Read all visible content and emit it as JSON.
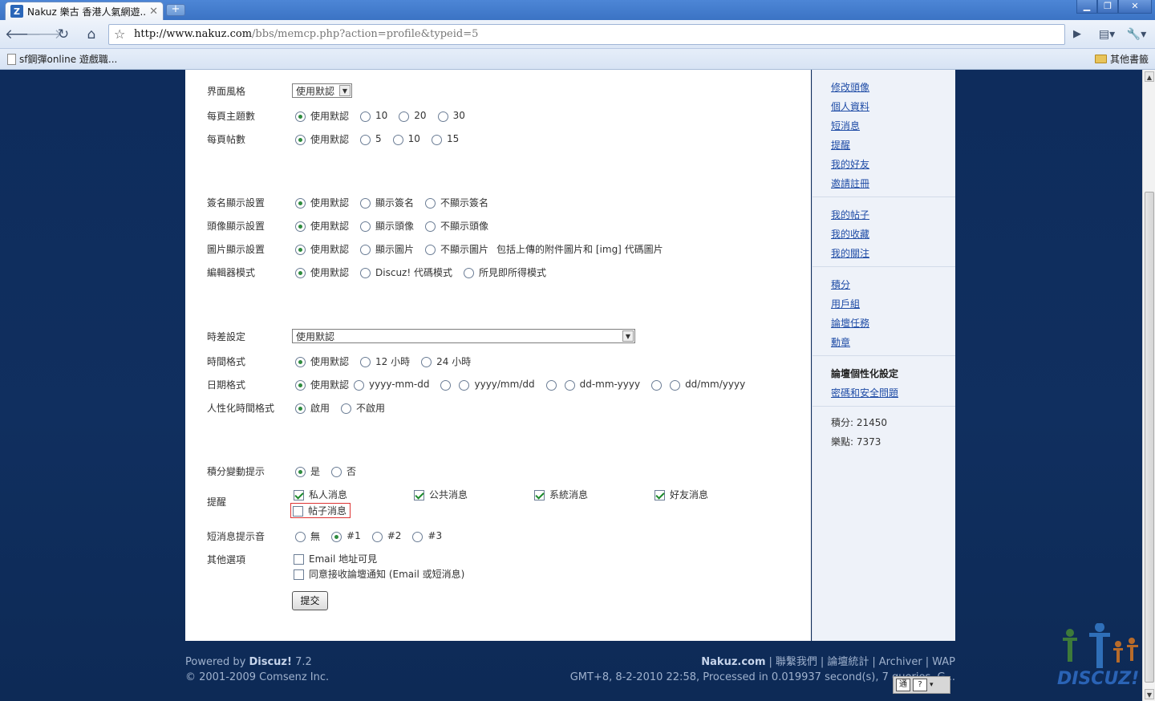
{
  "browser": {
    "tab_title": "Nakuz 樂古 香港人氣網遊...",
    "tab_icon": "Z",
    "new_tab": "+",
    "url_host": "http://www.nakuz.com",
    "url_path": "/bbs/memcp.php?action=profile&typeid=5",
    "bookmark_1": "sf鋼彈online 遊戲職...",
    "other_bookmarks": "其他書籤"
  },
  "form": {
    "style_label": "界面風格",
    "style_value": "使用默認",
    "tpp_label": "每頁主題數",
    "tpp_options": [
      "使用默認",
      "10",
      "20",
      "30"
    ],
    "ppp_label": "每頁帖數",
    "ppp_options": [
      "使用默認",
      "5",
      "10",
      "15"
    ],
    "sig_label": "簽名顯示設置",
    "sig_options": [
      "使用默認",
      "顯示簽名",
      "不顯示簽名"
    ],
    "avatar_label": "頭像顯示設置",
    "avatar_options": [
      "使用默認",
      "顯示頭像",
      "不顯示頭像"
    ],
    "image_label": "圖片顯示設置",
    "image_options": [
      "使用默認",
      "顯示圖片",
      "不顯示圖片"
    ],
    "image_note": "包括上傳的附件圖片和 [img] 代碼圖片",
    "editor_label": "編輯器模式",
    "editor_options": [
      "使用默認",
      "Discuz! 代碼模式",
      "所見即所得模式"
    ],
    "tz_label": "時差設定",
    "tz_value": "使用默認",
    "timefmt_label": "時間格式",
    "timefmt_options": [
      "使用默認",
      "12 小時",
      "24 小時"
    ],
    "datefmt_label": "日期格式",
    "datefmt_options": [
      "使用默認",
      "yyyy-mm-dd",
      "yyyy/mm/dd",
      "dd-mm-yyyy",
      "dd/mm/yyyy"
    ],
    "humantime_label": "人性化時間格式",
    "humantime_options": [
      "啟用",
      "不啟用"
    ],
    "credits_label": "積分變動提示",
    "credits_options": [
      "是",
      "否"
    ],
    "notify_label": "提醒",
    "notify_options": [
      "私人消息",
      "公共消息",
      "系統消息",
      "好友消息",
      "帖子消息"
    ],
    "pmsound_label": "短消息提示音",
    "pmsound_options": [
      "無",
      "#1",
      "#2",
      "#3"
    ],
    "other_label": "其他選項",
    "other_options": [
      "Email 地址可見",
      "同意接收論壇通知 (Email 或短消息)"
    ],
    "submit": "提交"
  },
  "sidebar": {
    "group1": [
      "修改頭像",
      "個人資料",
      "短消息",
      "提醒",
      "我的好友",
      "邀請註冊"
    ],
    "group2": [
      "我的帖子",
      "我的收藏",
      "我的關注"
    ],
    "group3": [
      "積分",
      "用戶組",
      "論壇任務",
      "勳章"
    ],
    "group4_title": "論壇個性化設定",
    "group4_link": "密碼和安全問題",
    "points": "積分: 21450",
    "happy": "樂點: 7373"
  },
  "footer": {
    "powered_prefix": "Powered by ",
    "powered_brand": "Discuz!",
    "powered_version": " 7.2",
    "copyright": "© 2001-2009 Comsenz Inc.",
    "site": "Nakuz.com",
    "links": [
      "聯繫我們",
      "論壇統計",
      "Archiver",
      "WAP"
    ],
    "stats": "GMT+8, 8-2-2010 22:58, Processed in 0.019937 second(s), 7 queries, G..."
  },
  "ime": {
    "btn1": "通",
    "btn2": "?"
  },
  "logo_text": "DISCUZ!",
  "colors": {
    "page_bg": "#0e2c5c",
    "link": "#1f4ca6",
    "sidebar_bg": "#eef2f9",
    "radio_on": "#2e8b3e"
  }
}
